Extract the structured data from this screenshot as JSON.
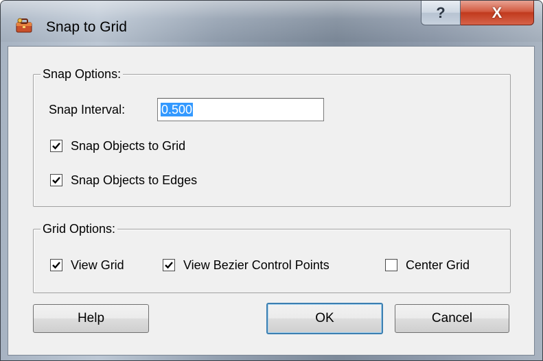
{
  "window": {
    "title": "Snap to Grid",
    "help_glyph": "?",
    "close_glyph": "X",
    "app_icon": "toolbox-icon"
  },
  "snap_options": {
    "legend": "Snap Options:",
    "interval_label": "Snap Interval:",
    "interval_value": "0.500",
    "checkboxes": [
      {
        "label": "Snap Objects to Grid",
        "checked": true
      },
      {
        "label": "Snap Objects to Edges",
        "checked": true
      }
    ]
  },
  "grid_options": {
    "legend": "Grid Options:",
    "checkboxes": [
      {
        "label": "View Grid",
        "checked": true
      },
      {
        "label": "View Bezier Control Points",
        "checked": true
      },
      {
        "label": "Center Grid",
        "checked": false
      }
    ]
  },
  "buttons": {
    "help": "Help",
    "ok": "OK",
    "cancel": "Cancel"
  },
  "colors": {
    "selection": "#3399ff",
    "close_button": "#c13a1d",
    "default_button_border": "#3c7fb1"
  }
}
